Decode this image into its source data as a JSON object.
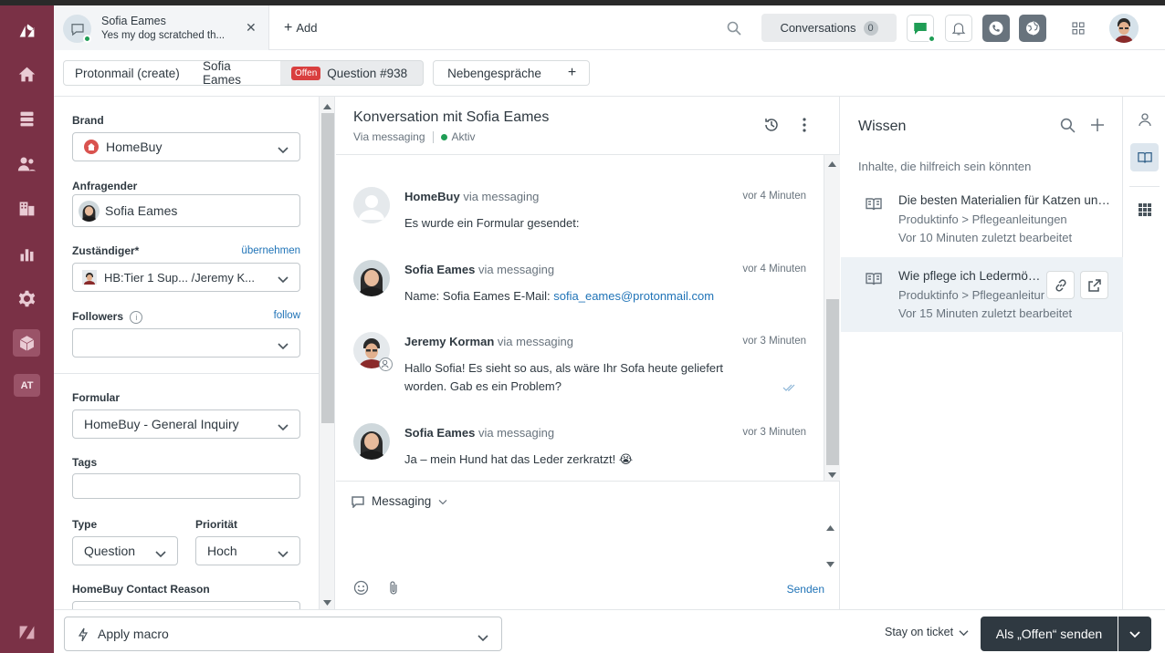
{
  "header": {
    "conversation_tab": {
      "name": "Sofia Eames",
      "preview": "Yes   my dog scratched th..."
    },
    "add_label": "Add",
    "conversations_label": "Conversations",
    "conversations_count": "0"
  },
  "rail": {
    "at_badge": "AT"
  },
  "subtabs": {
    "tab1": "Protonmail (create)",
    "tab2": "Sofia Eames",
    "status_badge": "Offen",
    "tab3": "Question #938",
    "tab4": "Nebengespräche",
    "tab_add": "+"
  },
  "form": {
    "brand_label": "Brand",
    "brand_value": "HomeBuy",
    "requester_label": "Anfragender",
    "requester_value": "Sofia Eames",
    "assignee_label": "Zuständiger*",
    "assignee_link": "übernehmen",
    "assignee_value": "HB:Tier 1 Sup...  /Jeremy K...",
    "followers_label": "Followers",
    "followers_link": "follow",
    "form_label": "Formular",
    "form_value": "HomeBuy - General Inquiry",
    "tags_label": "Tags",
    "type_label": "Type",
    "type_value": "Question",
    "priority_label": "Priorität",
    "priority_value": "Hoch",
    "contact_reason_label": "HomeBuy Contact Reason"
  },
  "conversation": {
    "title": "Konversation mit Sofia Eames",
    "channel": "Via messaging",
    "status": "Aktiv",
    "messages": [
      {
        "sender": "HomeBuy",
        "via": "via messaging",
        "time": "vor 4 Minuten",
        "text": "Es wurde ein Formular gesendet:",
        "link": ""
      },
      {
        "sender": "Sofia Eames",
        "via": "via messaging",
        "time": "vor 4 Minuten",
        "text": "Name: Sofia Eames E-Mail: ",
        "link": "sofia_eames@protonmail.com"
      },
      {
        "sender": "Jeremy Korman",
        "via": "via messaging",
        "time": "vor 3 Minuten",
        "text": "Hallo Sofia! Es sieht so aus, als wäre Ihr Sofa heute geliefert worden. Gab es ein Problem?",
        "link": ""
      },
      {
        "sender": "Sofia Eames",
        "via": "via messaging",
        "time": "vor 3 Minuten",
        "text": "Ja – mein Hund hat das Leder zerkratzt! 😭",
        "link": ""
      }
    ],
    "composer_channel": "Messaging",
    "send_label": "Senden"
  },
  "knowledge": {
    "title": "Wissen",
    "subtitle": "Inhalte, die hilfreich sein könnten",
    "articles": [
      {
        "title": "Die besten Materialien für Katzen und Hunde",
        "path": "Produktinfo > Pflegeanleitungen",
        "edited": "Vor 10 Minuten zuletzt bearbeitet"
      },
      {
        "title": "Wie pflege ich Ledermöbel?",
        "path": "Produktinfo > Pflegeanleitungen",
        "edited": "Vor 15 Minuten zuletzt bearbeitet"
      }
    ]
  },
  "footer": {
    "macro_label": "Apply macro",
    "stay_label": "Stay on ticket",
    "submit_label": "Als „Offen“ senden"
  },
  "colors": {
    "rail": "#7a3146",
    "accent_link": "#1f73b7",
    "status_green": "#1f9d55",
    "offen_badge": "#d93f3f",
    "submit": "#2f3941"
  }
}
